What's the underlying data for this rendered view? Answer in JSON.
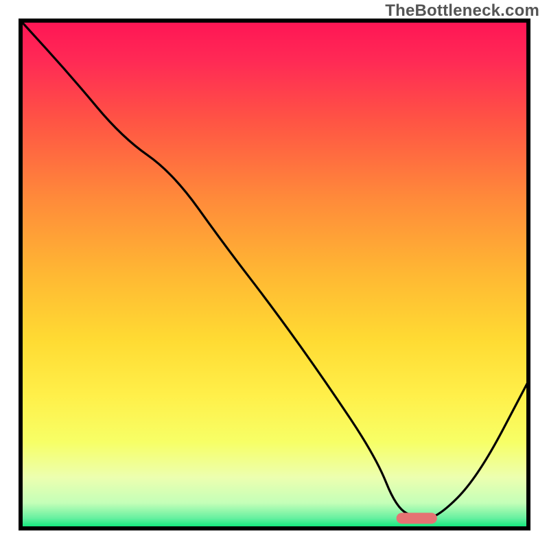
{
  "watermark": "TheBottleneck.com",
  "chart_data": {
    "type": "line",
    "title": "",
    "xlabel": "",
    "ylabel": "",
    "xlim": [
      0,
      100
    ],
    "ylim": [
      0,
      100
    ],
    "grid": false,
    "legend": false,
    "gradient_colors_top_to_bottom": [
      "#ff1744",
      "#ff5252",
      "#ff7043",
      "#ffa726",
      "#ffca28",
      "#ffee58",
      "#fff176",
      "#f4ff81",
      "#ccff90",
      "#00e676"
    ],
    "series": [
      {
        "name": "curve",
        "x": [
          0,
          10,
          20,
          30,
          40,
          50,
          60,
          70,
          74,
          78,
          82,
          90,
          100
        ],
        "y": [
          100,
          89,
          77,
          70,
          56,
          43,
          29,
          14,
          4,
          2,
          2,
          10,
          29
        ]
      }
    ],
    "marker": {
      "name": "optimum-marker",
      "x_start": 74,
      "x_end": 82,
      "y": 2,
      "color": "#e57373"
    }
  },
  "frame": {
    "stroke": "#000000",
    "stroke_width": 5
  }
}
